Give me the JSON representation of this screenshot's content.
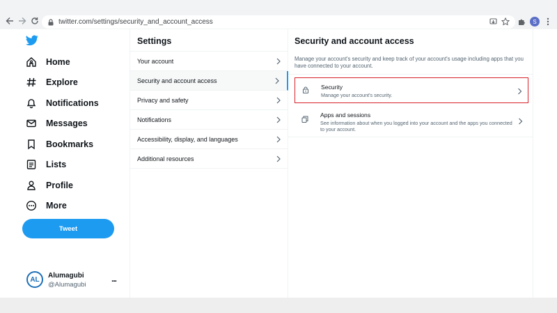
{
  "browser": {
    "url": "twitter.com/settings/security_and_account_access",
    "profile_initial": "S"
  },
  "left_nav": {
    "items": [
      {
        "label": "Home",
        "icon": "home-icon"
      },
      {
        "label": "Explore",
        "icon": "hashtag-icon"
      },
      {
        "label": "Notifications",
        "icon": "bell-icon"
      },
      {
        "label": "Messages",
        "icon": "envelope-icon"
      },
      {
        "label": "Bookmarks",
        "icon": "bookmark-icon"
      },
      {
        "label": "Lists",
        "icon": "list-icon"
      },
      {
        "label": "Profile",
        "icon": "person-icon"
      },
      {
        "label": "More",
        "icon": "more-circle-icon"
      }
    ],
    "tweet_label": "Tweet",
    "account": {
      "avatar_text": "AL",
      "name": "Alumagubi",
      "handle": "@Alumagubi",
      "more": "..."
    }
  },
  "settings": {
    "title": "Settings",
    "items": [
      {
        "label": "Your account",
        "active": false
      },
      {
        "label": "Security and account access",
        "active": true
      },
      {
        "label": "Privacy and safety",
        "active": false
      },
      {
        "label": "Notifications",
        "active": false
      },
      {
        "label": "Accessibility, display, and languages",
        "active": false
      },
      {
        "label": "Additional resources",
        "active": false
      }
    ]
  },
  "detail": {
    "title": "Security and account access",
    "description": "Manage your account's security and keep track of your account's usage including apps that you have connected to your account.",
    "options": [
      {
        "title": "Security",
        "subtitle": "Manage your account's security.",
        "icon": "lock-icon"
      },
      {
        "title": "Apps and sessions",
        "subtitle": "See information about when you logged into your account and the apps you connected to your account.",
        "icon": "copy-icon"
      }
    ]
  },
  "colors": {
    "accent": "#1d9bf0",
    "highlight_border": "#d9222a"
  }
}
